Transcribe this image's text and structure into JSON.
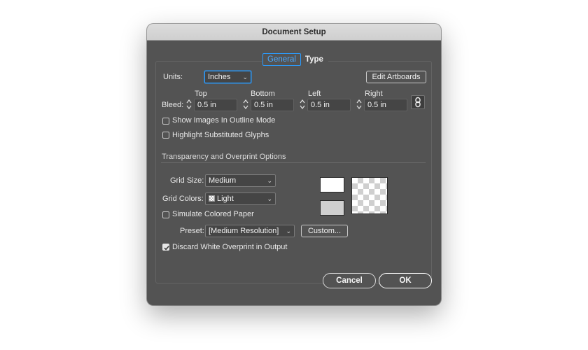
{
  "dialog": {
    "title": "Document Setup"
  },
  "tabs": [
    {
      "label": "General",
      "active": true
    },
    {
      "label": "Type",
      "active": false
    }
  ],
  "units": {
    "label": "Units:",
    "value": "Inches"
  },
  "edit_artboards_label": "Edit Artboards",
  "bleed": {
    "label": "Bleed:",
    "fields": [
      {
        "label": "Top",
        "value": "0.5 in"
      },
      {
        "label": "Bottom",
        "value": "0.5 in"
      },
      {
        "label": "Left",
        "value": "0.5 in"
      },
      {
        "label": "Right",
        "value": "0.5 in"
      }
    ],
    "link_icon": "link-icon"
  },
  "options": {
    "show_images_outline": {
      "label": "Show Images In Outline Mode",
      "checked": false
    },
    "highlight_glyphs": {
      "label": "Highlight Substituted Glyphs",
      "checked": false
    }
  },
  "transparency": {
    "section_title": "Transparency and Overprint Options",
    "grid_size": {
      "label": "Grid Size:",
      "value": "Medium"
    },
    "grid_colors": {
      "label": "Grid Colors:",
      "value": "Light"
    },
    "simulate_paper": {
      "label": "Simulate Colored Paper",
      "checked": false
    },
    "preset": {
      "label": "Preset:",
      "value": "[Medium Resolution]"
    },
    "custom_label": "Custom...",
    "discard_white": {
      "label": "Discard White Overprint in Output",
      "checked": true
    }
  },
  "footer": {
    "cancel_label": "Cancel",
    "ok_label": "OK"
  },
  "colors": {
    "dialog_bg": "#535353",
    "accent": "#2a9cff",
    "title_bg": "#d4d4d4"
  }
}
